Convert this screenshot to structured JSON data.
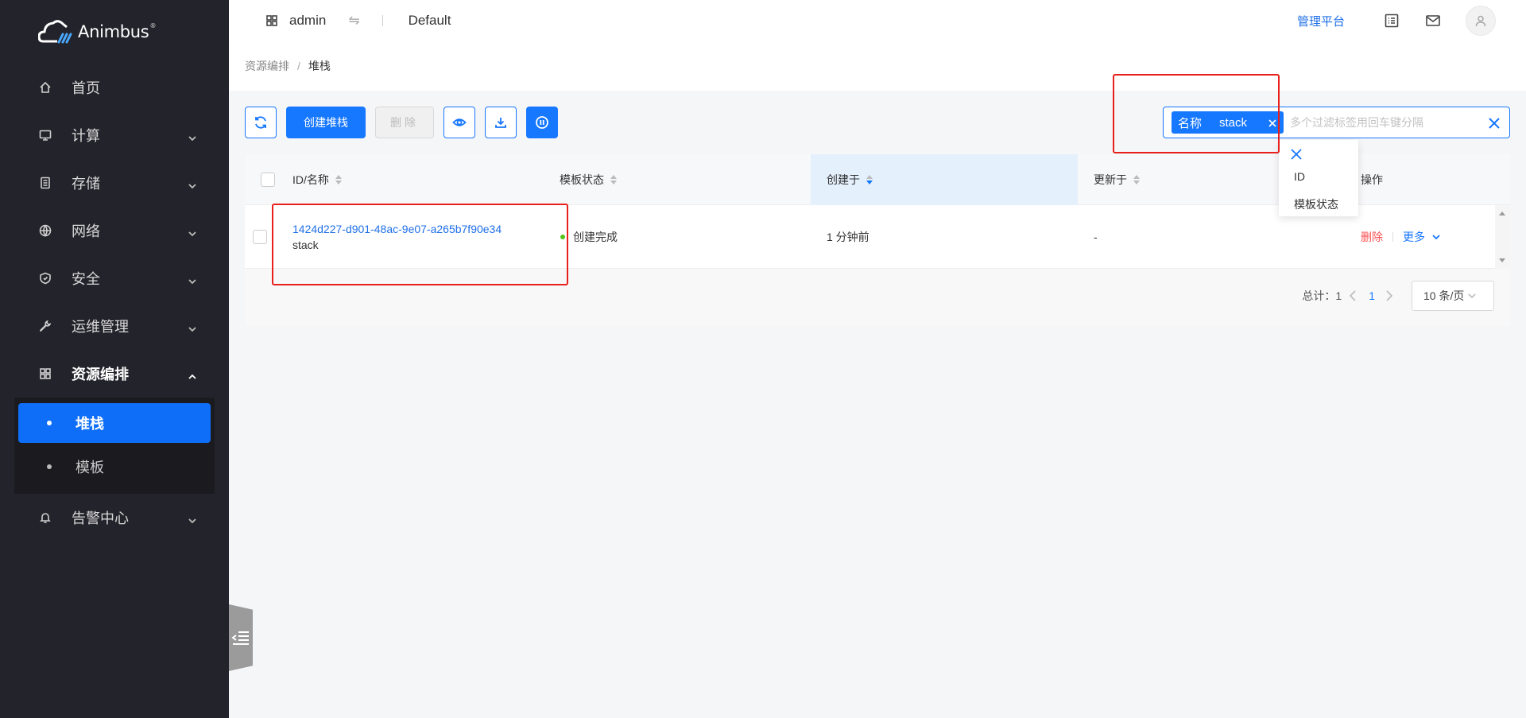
{
  "brand": {
    "name": "Animbus",
    "reg_mark": "®"
  },
  "sidebar": {
    "items": [
      {
        "label": "首页",
        "icon": "home-icon"
      },
      {
        "label": "计算",
        "icon": "monitor-icon"
      },
      {
        "label": "存储",
        "icon": "storage-icon"
      },
      {
        "label": "网络",
        "icon": "globe-icon"
      },
      {
        "label": "安全",
        "icon": "shield-icon"
      },
      {
        "label": "运维管理",
        "icon": "wrench-icon"
      },
      {
        "label": "资源编排",
        "icon": "grid-icon"
      },
      {
        "label": "告警中心",
        "icon": "bell-icon"
      }
    ],
    "sub_items": [
      {
        "label": "堆栈",
        "active": true
      },
      {
        "label": "模板",
        "active": false
      }
    ]
  },
  "header": {
    "user": "admin",
    "swap_glyph": "⇋",
    "project": "Default",
    "admin_platform": "管理平台"
  },
  "breadcrumb": {
    "parent": "资源编排",
    "separator": "/",
    "current": "堆栈"
  },
  "toolbar": {
    "create_label": "创建堆栈",
    "delete_label": "删除"
  },
  "search": {
    "tag_key": "名称",
    "tag_value": "stack",
    "placeholder": "多个过滤标签用回车键分隔",
    "dropdown_options": [
      "ID",
      "模板状态"
    ]
  },
  "table": {
    "columns": [
      "ID/名称",
      "模板状态",
      "创建于",
      "更新于",
      "操作"
    ],
    "rows": [
      {
        "id": "1424d227-d901-48ac-9e07-a265b7f90e34",
        "name": "stack",
        "status": "创建完成",
        "created": "1 分钟前",
        "updated": "-",
        "action_delete": "删除",
        "action_more": "更多"
      }
    ]
  },
  "pagination": {
    "total_label": "总计：1",
    "current_page": "1",
    "page_size": "10 条/页"
  },
  "colors": {
    "primary": "#1677ff",
    "sidebar_bg": "#23232b",
    "danger": "#ff4d4f",
    "success": "#52c41a",
    "annotation": "#e8201b"
  }
}
